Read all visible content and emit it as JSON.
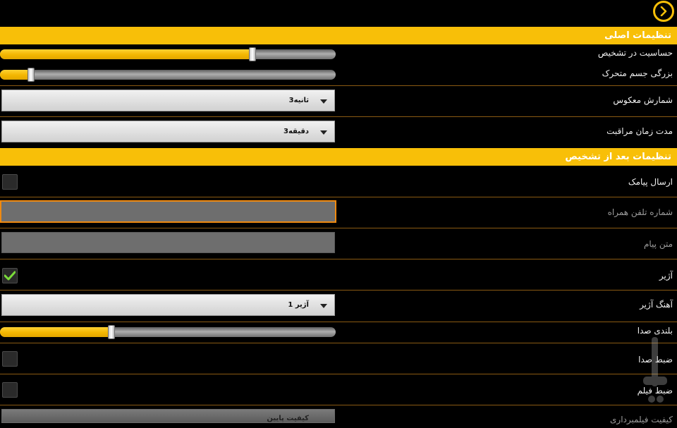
{
  "toolbar": {
    "back_icon": "chevron-right-circle-icon",
    "accent_color": "#f8bf08"
  },
  "sections": {
    "main_title": "تنظیمات اصلی",
    "after_detection_title": "تنظیمات بعد از تشخیص"
  },
  "main_settings": {
    "sensitivity_label": "حساسیت در تشخیص",
    "sensitivity_value": 0.75,
    "object_size_label": "بزرگی جسم متحرک",
    "object_size_value": 0.09,
    "countdown_label": "شمارش معکوس",
    "countdown_value": "3ثانیه",
    "guard_duration_label": "مدت زمان مراقبت",
    "guard_duration_value": "3دقیقه"
  },
  "after_detection": {
    "send_sms_label": "ارسال پیامک",
    "send_sms_checked": false,
    "phone_placeholder": "شماره تلفن همراه",
    "message_placeholder": "متن پیام",
    "siren_label": "آژیر",
    "siren_checked": true,
    "siren_tone_label": "آهنگ آژیر",
    "siren_tone_value": "آژیر 1",
    "volume_label": "بلندی صدا",
    "volume_value": 0.33,
    "record_audio_label": "ضبط صدا",
    "record_audio_checked": false,
    "record_video_label": "ضبط فیلم",
    "record_video_checked": false,
    "video_quality_label": "کیفیت فیلمبرداری",
    "video_quality_value": "کیفیت پایین"
  }
}
